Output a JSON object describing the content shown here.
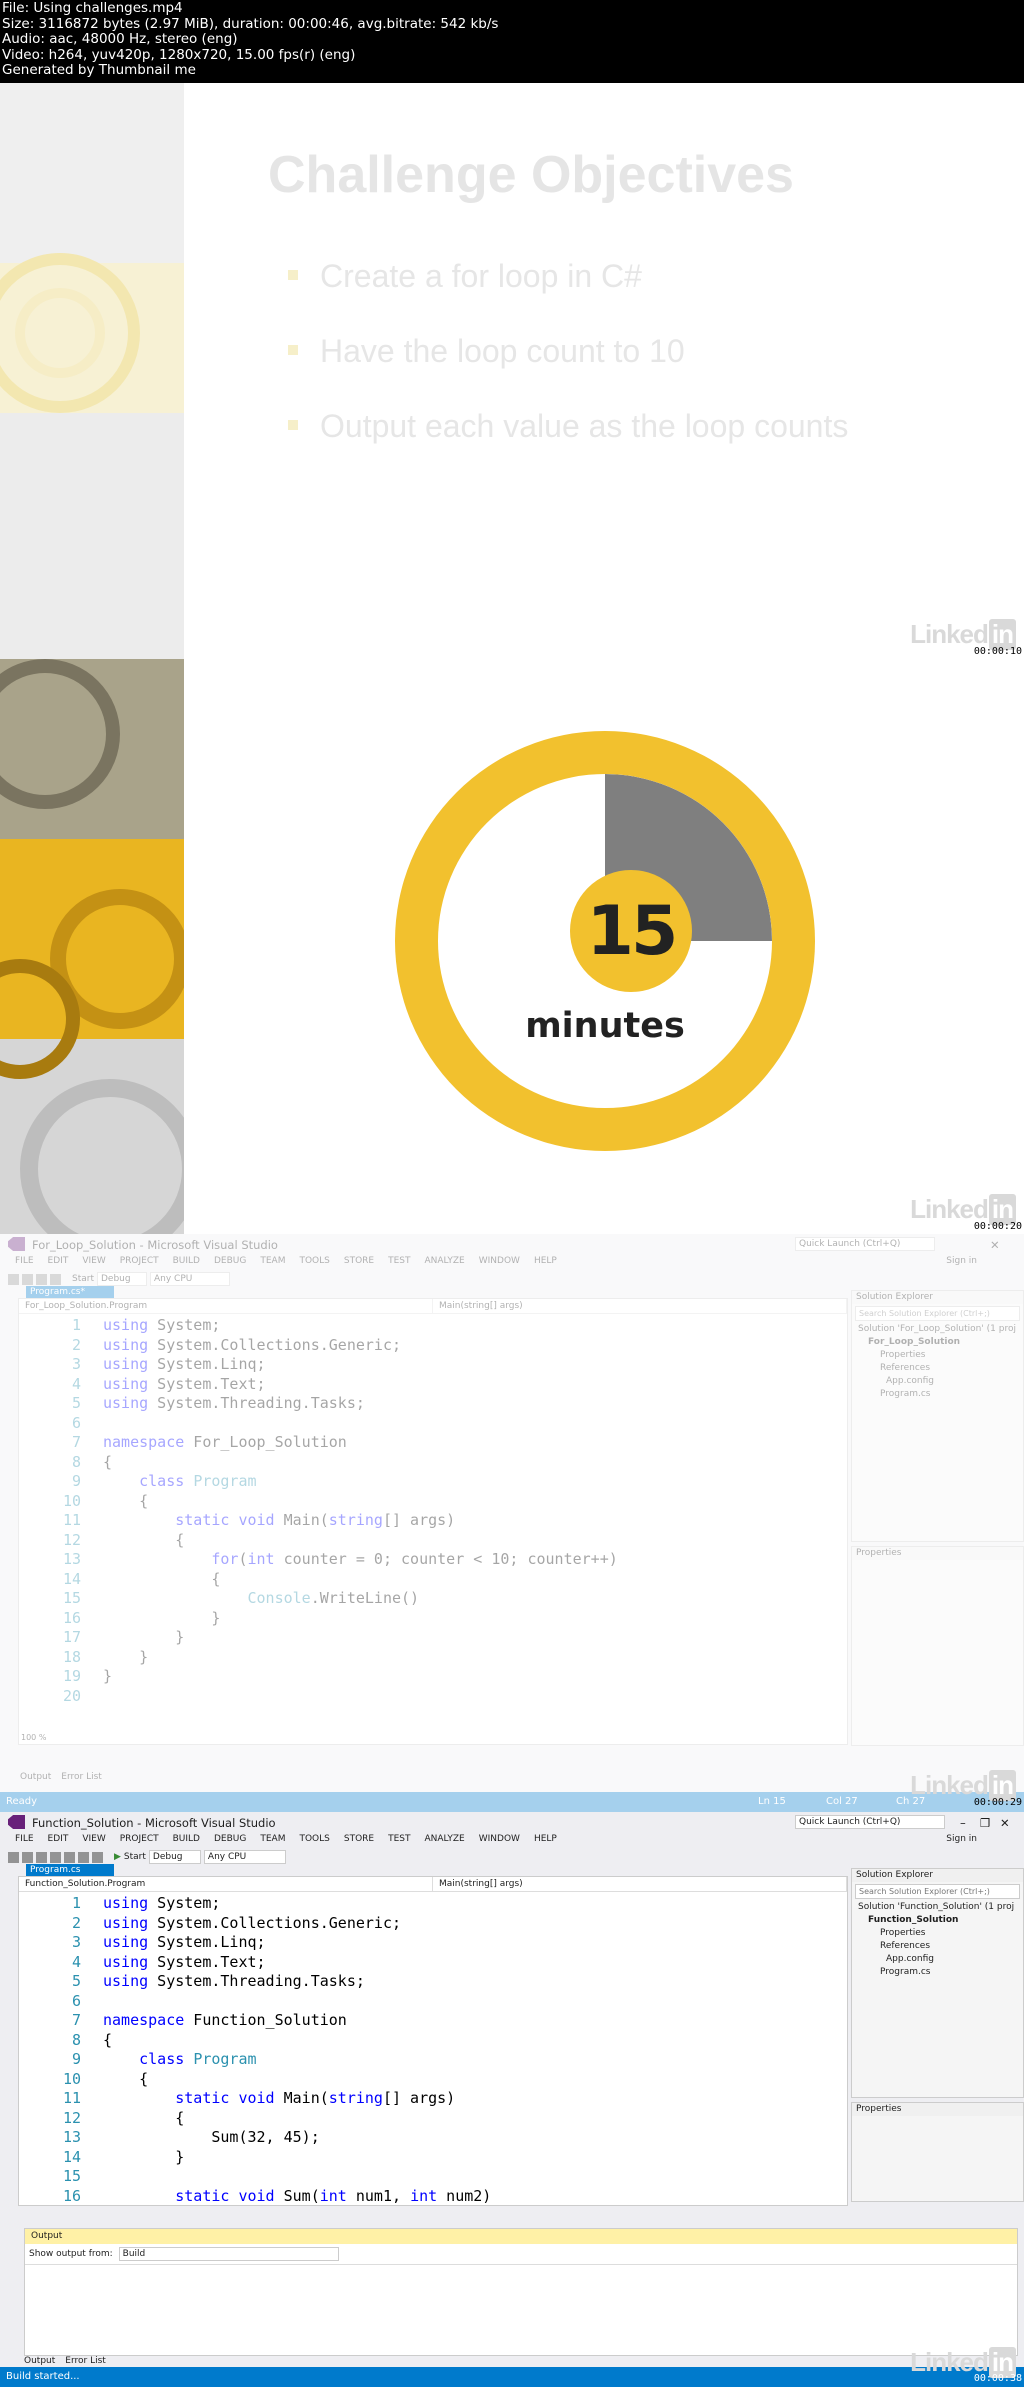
{
  "header": {
    "line1": "File: Using challenges.mp4",
    "line2": "Size: 3116872 bytes (2.97 MiB), duration: 00:00:46, avg.bitrate: 542 kb/s",
    "line3": "Audio: aac, 48000 Hz, stereo (eng)",
    "line4": "Video: h264, yuv420p, 1280x720, 15.00 fps(r) (eng)",
    "line5": "Generated by Thumbnail me"
  },
  "watermark": {
    "brand": "Linked",
    "brand_in": "in"
  },
  "timecodes": [
    "00:00:10",
    "00:00:20",
    "00:00:29",
    "00:00:38"
  ],
  "slide1": {
    "title": "Challenge Objectives",
    "bullets": [
      "Create a for loop in C#",
      "Have the loop count to 10",
      "Output each value as the loop counts"
    ]
  },
  "slide2": {
    "number": "15",
    "unit": "minutes",
    "elapsed_fraction": 0.25
  },
  "vs1": {
    "title": "For_Loop_Solution - Microsoft Visual Studio",
    "menu": [
      "FILE",
      "EDIT",
      "VIEW",
      "PROJECT",
      "BUILD",
      "DEBUG",
      "TEAM",
      "TOOLS",
      "STORE",
      "TEST",
      "ANALYZE",
      "WINDOW",
      "HELP"
    ],
    "quick_launch": "Quick Launch (Ctrl+Q)",
    "sign_in": "Sign in",
    "config": "Debug",
    "platform": "Any CPU",
    "start": "Start",
    "tab": "Program.cs*",
    "nav_left": "For_Loop_Solution.Program",
    "nav_right": "Main(string[] args)",
    "zoom": "100 %",
    "solution_explorer": "Solution Explorer",
    "se_search": "Search Solution Explorer (Ctrl+;)",
    "tree": [
      "Solution 'For_Loop_Solution' (1 proj",
      "For_Loop_Solution",
      "Properties",
      "References",
      "App.config",
      "Program.cs"
    ],
    "properties": "Properties",
    "bottom_tabs": [
      "Output",
      "Error List"
    ],
    "status": "Ready",
    "status_ln": "Ln 15",
    "status_col": "Col 27",
    "status_ch": "Ch 27",
    "code": [
      "using System;",
      "using System.Collections.Generic;",
      "using System.Linq;",
      "using System.Text;",
      "using System.Threading.Tasks;",
      "",
      "namespace For_Loop_Solution",
      "{",
      "    class Program",
      "    {",
      "        static void Main(string[] args)",
      "        {",
      "            for(int counter = 0; counter < 10; counter++)",
      "            {",
      "                Console.WriteLine()",
      "            }",
      "        }",
      "    }",
      "}",
      ""
    ]
  },
  "vs2": {
    "title": "Function_Solution - Microsoft Visual Studio",
    "menu": [
      "FILE",
      "EDIT",
      "VIEW",
      "PROJECT",
      "BUILD",
      "DEBUG",
      "TEAM",
      "TOOLS",
      "STORE",
      "TEST",
      "ANALYZE",
      "WINDOW",
      "HELP"
    ],
    "quick_launch": "Quick Launch (Ctrl+Q)",
    "sign_in": "Sign in",
    "config": "Debug",
    "platform": "Any CPU",
    "start": "Start",
    "tab": "Program.cs",
    "nav_left": "Function_Solution.Program",
    "nav_right": "Main(string[] args)",
    "solution_explorer": "Solution Explorer",
    "se_search": "Search Solution Explorer (Ctrl+;)",
    "tree": [
      "Solution 'Function_Solution' (1 proj",
      "Function_Solution",
      "Properties",
      "References",
      "App.config",
      "Program.cs"
    ],
    "properties": "Properties",
    "output_title": "Output",
    "show_output_from": "Show output from:",
    "output_source": "Build",
    "bottom_tabs": [
      "Output",
      "Error List"
    ],
    "status": "Build started...",
    "code": [
      "using System;",
      "using System.Collections.Generic;",
      "using System.Linq;",
      "using System.Text;",
      "using System.Threading.Tasks;",
      "",
      "namespace Function_Solution",
      "{",
      "    class Program",
      "    {",
      "        static void Main(string[] args)",
      "        {",
      "            Sum(32, 45);",
      "        }",
      "",
      "        static void Sum(int num1, int num2)"
    ]
  }
}
